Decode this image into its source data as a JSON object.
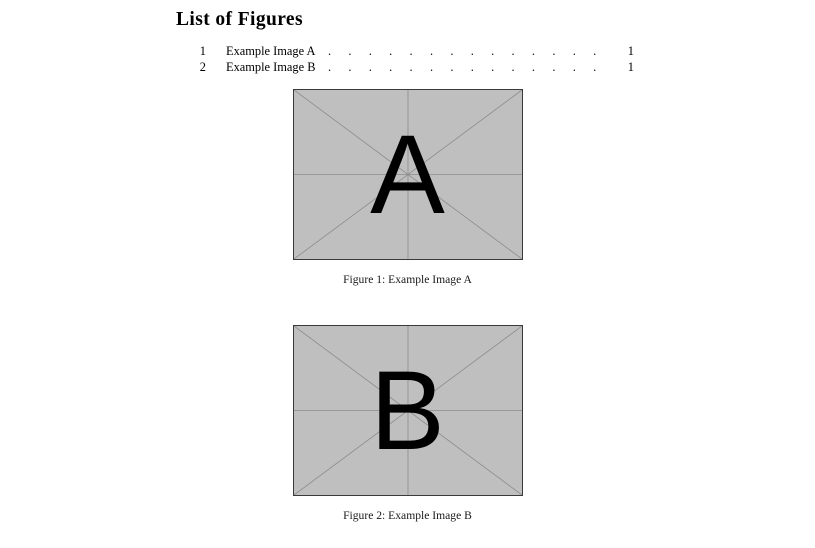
{
  "page": {
    "background_color": "#ffffff",
    "text_color": "#000000"
  },
  "heading": {
    "title": "List of Figures"
  },
  "toc": {
    "leader_dots": ". . . . . . . . . . . . . . . . . . . . . . . . . . . . . . . . . . . . . .",
    "entries": [
      {
        "number": "1",
        "label": "Example Image A",
        "page": "1"
      },
      {
        "number": "2",
        "label": "Example Image B",
        "page": "1"
      }
    ]
  },
  "figures": [
    {
      "id": "figure-1",
      "placeholder_letter": "A",
      "fill_color": "#bfbfbf",
      "border_color": "#3a3a3a",
      "guide_color": "#8c8c8c",
      "caption_prefix": "Figure 1:",
      "caption_text": "Example Image A",
      "caption_full": "Figure 1:  Example Image A"
    },
    {
      "id": "figure-2",
      "placeholder_letter": "B",
      "fill_color": "#bfbfbf",
      "border_color": "#3a3a3a",
      "guide_color": "#8c8c8c",
      "caption_prefix": "Figure 2:",
      "caption_text": "Example Image B",
      "caption_full": "Figure 2:  Example Image B"
    }
  ]
}
